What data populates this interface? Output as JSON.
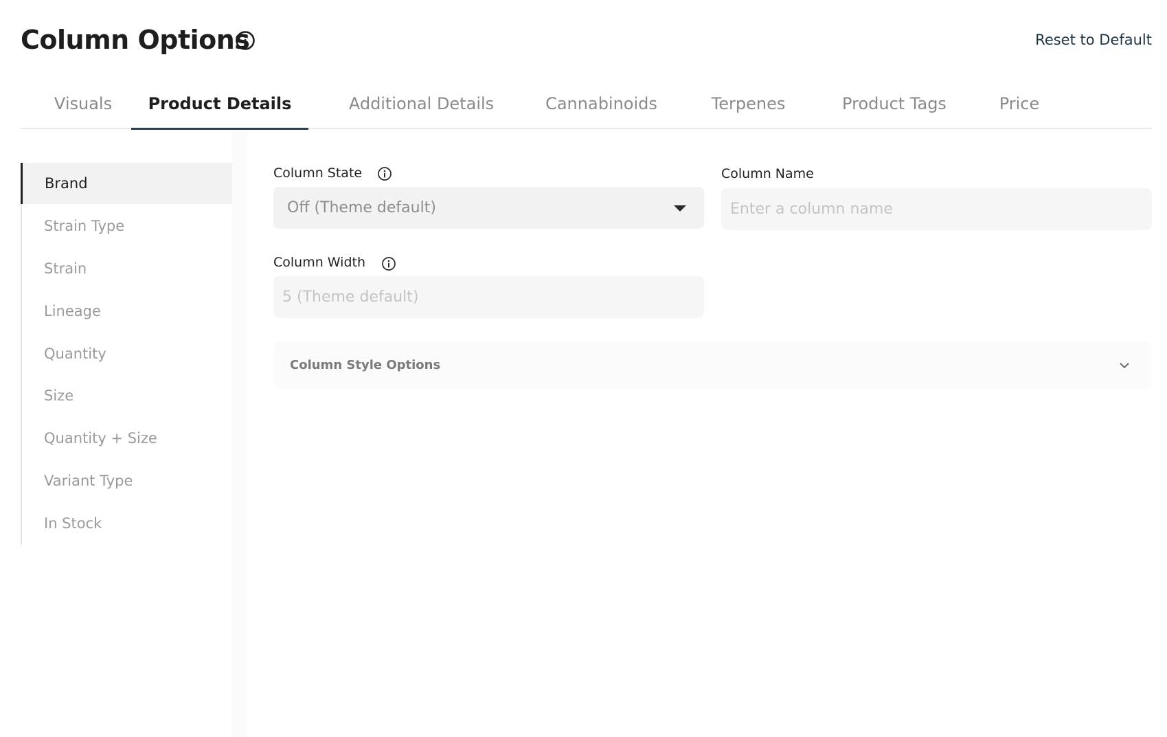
{
  "header": {
    "title": "Column Options",
    "reset_label": "Reset to Default"
  },
  "tabs": [
    {
      "label": "Visuals",
      "active": false
    },
    {
      "label": "Product Details",
      "active": true
    },
    {
      "label": "Additional Details",
      "active": false
    },
    {
      "label": "Cannabinoids",
      "active": false
    },
    {
      "label": "Terpenes",
      "active": false
    },
    {
      "label": "Product Tags",
      "active": false
    },
    {
      "label": "Price",
      "active": false
    }
  ],
  "sidebar": {
    "items": [
      {
        "label": "Brand",
        "active": true
      },
      {
        "label": "Strain Type",
        "active": false
      },
      {
        "label": "Strain",
        "active": false
      },
      {
        "label": "Lineage",
        "active": false
      },
      {
        "label": "Quantity",
        "active": false
      },
      {
        "label": "Size",
        "active": false
      },
      {
        "label": "Quantity + Size",
        "active": false
      },
      {
        "label": "Variant Type",
        "active": false
      },
      {
        "label": "In Stock",
        "active": false
      }
    ]
  },
  "form": {
    "column_state": {
      "label": "Column State",
      "value": "Off (Theme default)"
    },
    "column_name": {
      "label": "Column Name",
      "value": "",
      "placeholder": "Enter a column name"
    },
    "column_width": {
      "label": "Column Width",
      "value": "",
      "placeholder": "5 (Theme default)"
    },
    "style_options": {
      "label": "Column Style Options"
    }
  },
  "colors": {
    "active_tab_underline": "#2a3f50",
    "reset_link": "#1f3340",
    "sidebar_active_bg": "#f2f2f2",
    "input_bg": "#f2f2f2"
  },
  "icons": {
    "title_info": "info-circle-icon",
    "state_info": "info-circle-icon",
    "width_info": "info-circle-icon",
    "select_arrow": "caret-down-icon",
    "accordion_chevron": "chevron-down-icon",
    "tab_indicator": "caret-up-icon"
  }
}
